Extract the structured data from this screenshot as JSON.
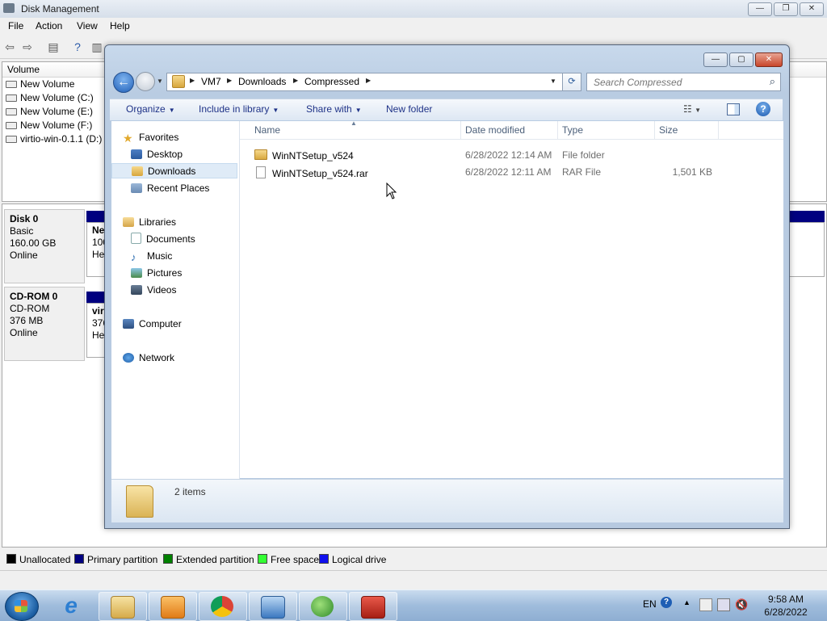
{
  "disk_management": {
    "title": "Disk Management",
    "menu": [
      "File",
      "Action",
      "View",
      "Help"
    ],
    "column_volume": "Volume",
    "volumes": [
      "New Volume",
      "New Volume (C:)",
      "New Volume (E:)",
      "New Volume (F:)",
      "virtio-win-0.1.1 (D:)"
    ],
    "disks": [
      {
        "name": "Disk 0",
        "type": "Basic",
        "size": "160.00 GB",
        "status": "Online",
        "part_name": "Ne",
        "part_size": "100",
        "part_status": "He"
      },
      {
        "name": "CD-ROM 0",
        "type": "CD-ROM",
        "size": "376 MB",
        "status": "Online",
        "part_name": "vir",
        "part_size": "376",
        "part_status": "He"
      }
    ],
    "legend": [
      {
        "label": "Unallocated",
        "color": "#000000"
      },
      {
        "label": "Primary partition",
        "color": "#000080"
      },
      {
        "label": "Extended partition",
        "color": "#008000"
      },
      {
        "label": "Free space",
        "color": "#33ff33"
      },
      {
        "label": "Logical drive",
        "color": "#1010ee"
      }
    ]
  },
  "explorer": {
    "breadcrumb": [
      "VM7",
      "Downloads",
      "Compressed"
    ],
    "search_placeholder": "Search Compressed",
    "commands": {
      "organize": "Organize",
      "include": "Include in library",
      "share": "Share with",
      "new_folder": "New folder"
    },
    "nav": {
      "favorites": "Favorites",
      "desktop": "Desktop",
      "downloads": "Downloads",
      "recent": "Recent Places",
      "libraries": "Libraries",
      "documents": "Documents",
      "music": "Music",
      "pictures": "Pictures",
      "videos": "Videos",
      "computer": "Computer",
      "network": "Network"
    },
    "columns": {
      "name": "Name",
      "date": "Date modified",
      "type": "Type",
      "size": "Size"
    },
    "files": [
      {
        "name": "WinNTSetup_v524",
        "date": "6/28/2022 12:14 AM",
        "type": "File folder",
        "size": ""
      },
      {
        "name": "WinNTSetup_v524.rar",
        "date": "6/28/2022 12:11 AM",
        "type": "RAR File",
        "size": "1,501 KB"
      }
    ],
    "item_count": "2 items"
  },
  "taskbar": {
    "lang": "EN",
    "time": "9:58 AM",
    "date": "6/28/2022",
    "icons": [
      "windows-explorer-icon",
      "media-player-icon",
      "chrome-icon",
      "control-panel-icon",
      "download-manager-icon",
      "toolbox-icon"
    ]
  }
}
